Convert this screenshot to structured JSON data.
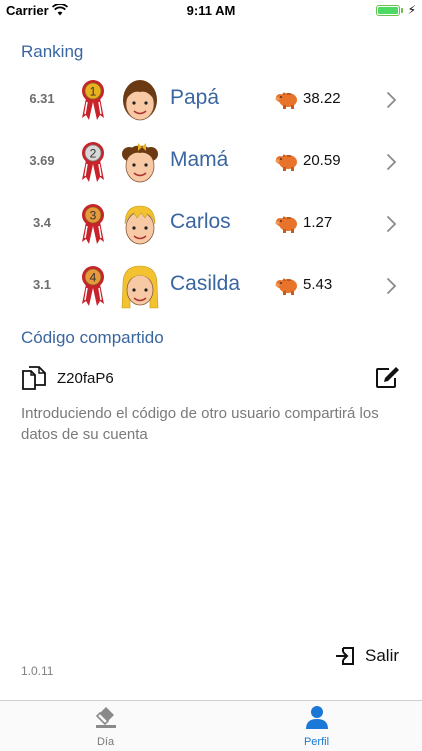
{
  "status_bar": {
    "carrier": "Carrier",
    "time": "9:11 AM"
  },
  "ranking": {
    "title": "Ranking",
    "members": [
      {
        "score": "6.31",
        "position": "1",
        "name": "Papá",
        "amount": "38.22",
        "medal_color": "#e8b21e"
      },
      {
        "score": "3.69",
        "position": "2",
        "name": "Mamá",
        "amount": "20.59",
        "medal_color": "#d8d8d8"
      },
      {
        "score": "3.4",
        "position": "3",
        "name": "Carlos",
        "amount": "1.27",
        "medal_color": "#e69a3c"
      },
      {
        "score": "3.1",
        "position": "4",
        "name": "Casilda",
        "amount": "5.43",
        "medal_color": "#e69a3c"
      }
    ]
  },
  "shared_code": {
    "title": "Código compartido",
    "code": "Z20faP6",
    "help_text": "Introduciendo el código de otro usuario compartirá los datos de su cuenta"
  },
  "logout": {
    "label": "Salir"
  },
  "version": "1.0.11",
  "tabs": [
    {
      "label": "Día",
      "icon": "eraser-icon",
      "active": false
    },
    {
      "label": "Perfil",
      "icon": "person-icon",
      "active": true
    }
  ],
  "colors": {
    "accent": "#3a66a0",
    "tab_active": "#1a78d6",
    "tab_inactive": "#7a7a7a"
  }
}
